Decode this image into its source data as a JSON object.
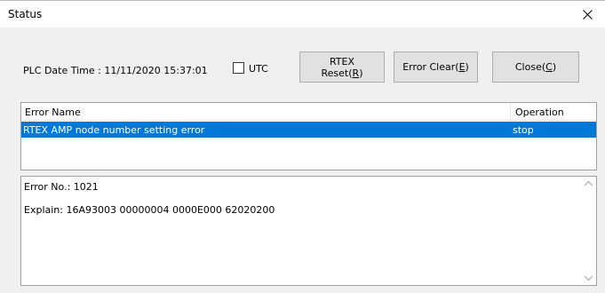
{
  "window": {
    "title": "Status"
  },
  "header": {
    "plc_label": "PLC Date Time :",
    "plc_value": "11/11/2020 15:37:01",
    "utc_label": "UTC",
    "utc_checked": false
  },
  "buttons": {
    "rtex_line1": "RTEX",
    "rtex_line2_prefix": "Reset(",
    "rtex_line2_key": "R",
    "rtex_line2_suffix": ")",
    "clear_prefix": "Error Clear(",
    "clear_key": "E",
    "clear_suffix": ")",
    "close_prefix": "Close(",
    "close_key": "C",
    "close_suffix": ")"
  },
  "table": {
    "columns": [
      "Error Name",
      "Operation"
    ],
    "rows": [
      {
        "name": "RTEX AMP node number setting error",
        "operation": "stop",
        "selected": true
      }
    ]
  },
  "detail": {
    "error_no_label": "Error No.:",
    "error_no_value": "1021",
    "explain_label": "Explain:",
    "explain_value": "16A93003 00000004 0000E000 62020200"
  },
  "icons": [
    "close-icon",
    "scroll-up-icon",
    "scroll-down-icon"
  ]
}
